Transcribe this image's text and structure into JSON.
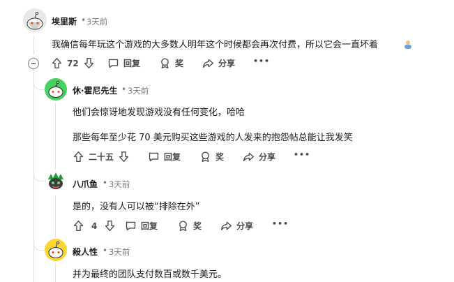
{
  "comments": [
    {
      "author": "埃里斯",
      "time": "3天前",
      "body": [
        "我确信每年玩这个游戏的大多数人明年这个时候都会再次付费，所以它会一直坏着"
      ],
      "votes": "72",
      "actions": {
        "reply": "回复",
        "award": "奖",
        "share": "分享",
        "more": "•••"
      },
      "avatar_icon": "reddit-snoo-avatar",
      "emoji_icon": "person-emoji-icon"
    },
    {
      "author": "休·霍尼先生",
      "time": "3天前",
      "body": [
        "他们会惊讶地发现游戏没有任何变化，哈哈",
        "那些每年至少花 70 美元购买这些游戏的人发来的抱怨帖总能让我发笑"
      ],
      "votes": "二十五",
      "actions": {
        "reply": "回复",
        "award": "奖",
        "share": "分享",
        "more": "•••"
      },
      "avatar_icon": "green-snoo-avatar"
    },
    {
      "author": "八爪鱼",
      "time": "3天前",
      "body": [
        "是的，没有人可以被“排除在外”"
      ],
      "votes": "4",
      "actions": {
        "reply": "回复",
        "award": "奖",
        "share": "分享",
        "more": "•••"
      },
      "avatar_icon": "dark-snoo-avatar"
    },
    {
      "author": "殺人性",
      "time": "3天前",
      "body": [
        "并为最终的团队支付数百或数千美元。"
      ],
      "avatar_icon": "yellow-snoo-avatar"
    }
  ],
  "separator": "•",
  "colors": {
    "text": "#1a1a1b",
    "meta": "#7c7c7c",
    "action": "#4a4a4a",
    "line": "#e0e0e0"
  }
}
